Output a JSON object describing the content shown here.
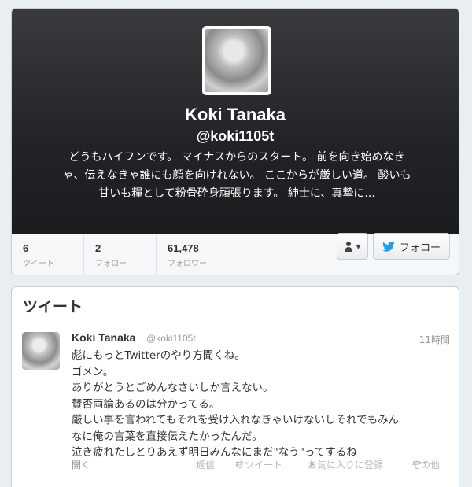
{
  "profile": {
    "name": "Koki Tanaka",
    "handle": "@koki1105t",
    "bio_lines": [
      "どうもハイフンです。 マイナスからのスタート。 前を向き始めなき",
      "ゃ、伝えなきゃ誰にも顔を向けれない。 ここからが厳しい道。 酸いも",
      "甘いも糧として粉骨砕身頑張ります。 紳士に、真摯に..."
    ]
  },
  "stats": [
    {
      "value": "6",
      "label": "ツイート"
    },
    {
      "value": "2",
      "label": "フォロー"
    },
    {
      "value": "61,478",
      "label": "フォロワー"
    }
  ],
  "buttons": {
    "user_menu_icon": "user-icon",
    "follow_label": "フォロー"
  },
  "tweets_section": {
    "title": "ツイート"
  },
  "tweet": {
    "name": "Koki Tanaka",
    "handle": "@koki1105t",
    "time": "11時間",
    "lines": [
      "彪にもっとTwitterのやり方聞くね。",
      "ゴメン。",
      "ありがとうとごめんなさいしか言えない。",
      "賛否両論あるのは分かってる。",
      "厳しい事を言われてもそれを受け入れなきゃいけないしそれでもみん",
      "なに俺の言葉を直接伝えたかったんだ。",
      "泣き疲れたしとりあえず明日みんなにまだ\"なう\"ってするね"
    ],
    "actions": {
      "open": "開く",
      "reply": "返信",
      "retweet": "リツイート",
      "favorite": "お気に入りに登録",
      "more": "その他"
    }
  },
  "colors": {
    "header_bg": "#222326",
    "page_bg": "#e9eef2",
    "twitter_blue": "#2a9be0"
  }
}
